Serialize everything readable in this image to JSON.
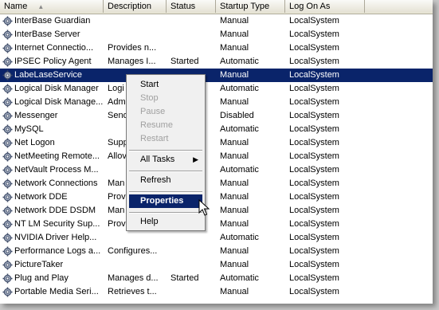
{
  "columns": {
    "name": "Name",
    "description": "Description",
    "status": "Status",
    "startup_type": "Startup Type",
    "log_on_as": "Log On As",
    "sort_indicator": "▲"
  },
  "services": [
    {
      "name": "InterBase Guardian",
      "description": "",
      "status": "",
      "startup": "Manual",
      "logon": "LocalSystem"
    },
    {
      "name": "InterBase Server",
      "description": "",
      "status": "",
      "startup": "Manual",
      "logon": "LocalSystem"
    },
    {
      "name": "Internet Connectio...",
      "description": "Provides n...",
      "status": "",
      "startup": "Manual",
      "logon": "LocalSystem"
    },
    {
      "name": "IPSEC Policy Agent",
      "description": "Manages I...",
      "status": "Started",
      "startup": "Automatic",
      "logon": "LocalSystem"
    },
    {
      "name": "LabeLaseService",
      "description": "",
      "status": "",
      "startup": "Manual",
      "logon": "LocalSystem"
    },
    {
      "name": "Logical Disk Manager",
      "description": "Logi",
      "status": "",
      "startup": "Automatic",
      "logon": "LocalSystem"
    },
    {
      "name": "Logical Disk Manage...",
      "description": "Adm",
      "status": "",
      "startup": "Manual",
      "logon": "LocalSystem"
    },
    {
      "name": "Messenger",
      "description": "Send",
      "status": "",
      "startup": "Disabled",
      "logon": "LocalSystem"
    },
    {
      "name": "MySQL",
      "description": "",
      "status": "",
      "startup": "Automatic",
      "logon": "LocalSystem"
    },
    {
      "name": "Net Logon",
      "description": "Supp",
      "status": "",
      "startup": "Manual",
      "logon": "LocalSystem"
    },
    {
      "name": "NetMeeting Remote...",
      "description": "Allov",
      "status": "",
      "startup": "Manual",
      "logon": "LocalSystem"
    },
    {
      "name": "NetVault Process M...",
      "description": "",
      "status": "",
      "startup": "Automatic",
      "logon": "LocalSystem"
    },
    {
      "name": "Network Connections",
      "description": "Man",
      "status": "",
      "startup": "Manual",
      "logon": "LocalSystem"
    },
    {
      "name": "Network DDE",
      "description": "Prov",
      "status": "",
      "startup": "Manual",
      "logon": "LocalSystem"
    },
    {
      "name": "Network DDE DSDM",
      "description": "Man",
      "status": "",
      "startup": "Manual",
      "logon": "LocalSystem"
    },
    {
      "name": "NT LM Security Sup...",
      "description": "Prov",
      "status": "",
      "startup": "Manual",
      "logon": "LocalSystem"
    },
    {
      "name": "NVIDIA Driver Help...",
      "description": "",
      "status": "",
      "startup": "Automatic",
      "logon": "LocalSystem"
    },
    {
      "name": "Performance Logs a...",
      "description": "Configures...",
      "status": "",
      "startup": "Manual",
      "logon": "LocalSystem"
    },
    {
      "name": "PictureTaker",
      "description": "",
      "status": "",
      "startup": "Manual",
      "logon": "LocalSystem"
    },
    {
      "name": "Plug and Play",
      "description": "Manages d...",
      "status": "Started",
      "startup": "Automatic",
      "logon": "LocalSystem"
    },
    {
      "name": "Portable Media Seri...",
      "description": "Retrieves t...",
      "status": "",
      "startup": "Manual",
      "logon": "LocalSystem"
    }
  ],
  "selected_index": 4,
  "context_menu": {
    "items": [
      {
        "label": "Start",
        "enabled": true
      },
      {
        "label": "Stop",
        "enabled": false
      },
      {
        "label": "Pause",
        "enabled": false
      },
      {
        "label": "Resume",
        "enabled": false
      },
      {
        "label": "Restart",
        "enabled": false
      },
      {
        "label": "All Tasks",
        "enabled": true,
        "submenu": true
      },
      {
        "label": "Refresh",
        "enabled": true
      },
      {
        "label": "Properties",
        "enabled": true,
        "highlighted": true
      },
      {
        "label": "Help",
        "enabled": true
      }
    ],
    "submenu_arrow": "▶"
  },
  "icons": {
    "service": "gear-icon",
    "cursor": "mouse-pointer-icon"
  },
  "colors": {
    "selection": "#0a246a",
    "header_bg": "#ece9d8",
    "menu_bg": "#f0f0f0"
  }
}
